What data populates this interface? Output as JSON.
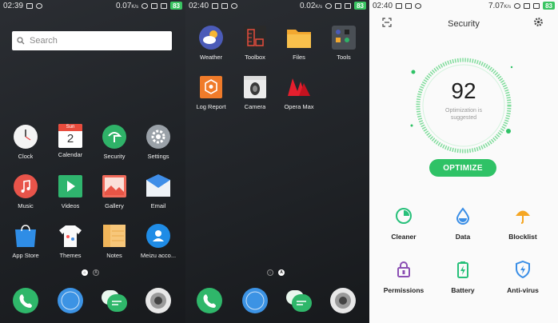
{
  "panel1": {
    "status": {
      "time": "02:39",
      "speed": "0.07",
      "speed_unit": "K/s",
      "battery": "83"
    },
    "search": {
      "placeholder": "Search"
    },
    "apps": [
      {
        "label": "Clock",
        "icon": "clock-icon"
      },
      {
        "label": "Calendar",
        "icon": "calendar-icon",
        "cal_day": "Sun",
        "cal_date": "2"
      },
      {
        "label": "Security",
        "icon": "security-icon"
      },
      {
        "label": "Settings",
        "icon": "settings-icon"
      },
      {
        "label": "Music",
        "icon": "music-icon"
      },
      {
        "label": "Videos",
        "icon": "videos-icon"
      },
      {
        "label": "Gallery",
        "icon": "gallery-icon"
      },
      {
        "label": "Email",
        "icon": "email-icon"
      },
      {
        "label": "App Store",
        "icon": "app-store-icon"
      },
      {
        "label": "Themes",
        "icon": "themes-icon"
      },
      {
        "label": "Notes",
        "icon": "notes-icon"
      },
      {
        "label": "Meizu acco...",
        "icon": "meizu-account-icon"
      }
    ],
    "dock": [
      "phone-icon",
      "browser-icon",
      "messages-icon",
      "camera-lens-icon"
    ],
    "page_indicator": {
      "pages": [
        "home",
        "A"
      ],
      "active": 0
    }
  },
  "panel2": {
    "status": {
      "time": "02:40",
      "speed": "0.02",
      "speed_unit": "K/s",
      "battery": "83"
    },
    "apps": [
      {
        "label": "Weather",
        "icon": "weather-icon"
      },
      {
        "label": "Toolbox",
        "icon": "toolbox-icon"
      },
      {
        "label": "Files",
        "icon": "files-icon"
      },
      {
        "label": "Tools",
        "icon": "tools-folder-icon"
      },
      {
        "label": "Log Report",
        "icon": "log-report-icon"
      },
      {
        "label": "Camera",
        "icon": "camera-icon"
      },
      {
        "label": "Opera Max",
        "icon": "opera-max-icon"
      }
    ],
    "dock": [
      "phone-icon",
      "browser-icon",
      "messages-icon",
      "camera-lens-icon"
    ],
    "page_indicator": {
      "pages": [
        "home",
        "A"
      ],
      "active": 1
    }
  },
  "panel3": {
    "status": {
      "time": "02:40",
      "speed": "7.07",
      "speed_unit": "K/s",
      "battery": "83"
    },
    "title": "Security",
    "score": "92",
    "score_subtitle": "Optimization is suggested",
    "optimize_label": "OPTIMIZE",
    "tools": [
      {
        "label": "Cleaner",
        "icon": "cleaner-icon"
      },
      {
        "label": "Data",
        "icon": "data-drop-icon"
      },
      {
        "label": "Blocklist",
        "icon": "blocklist-umbrella-icon"
      },
      {
        "label": "Permissions",
        "icon": "permissions-lock-icon"
      },
      {
        "label": "Battery",
        "icon": "battery-icon"
      },
      {
        "label": "Anti-virus",
        "icon": "anti-virus-shield-icon"
      }
    ],
    "colors": {
      "accent": "#2fc266",
      "blue": "#3a8ee6",
      "orange": "#f5a623",
      "purple": "#8b4fb3",
      "green": "#27c07a"
    }
  }
}
